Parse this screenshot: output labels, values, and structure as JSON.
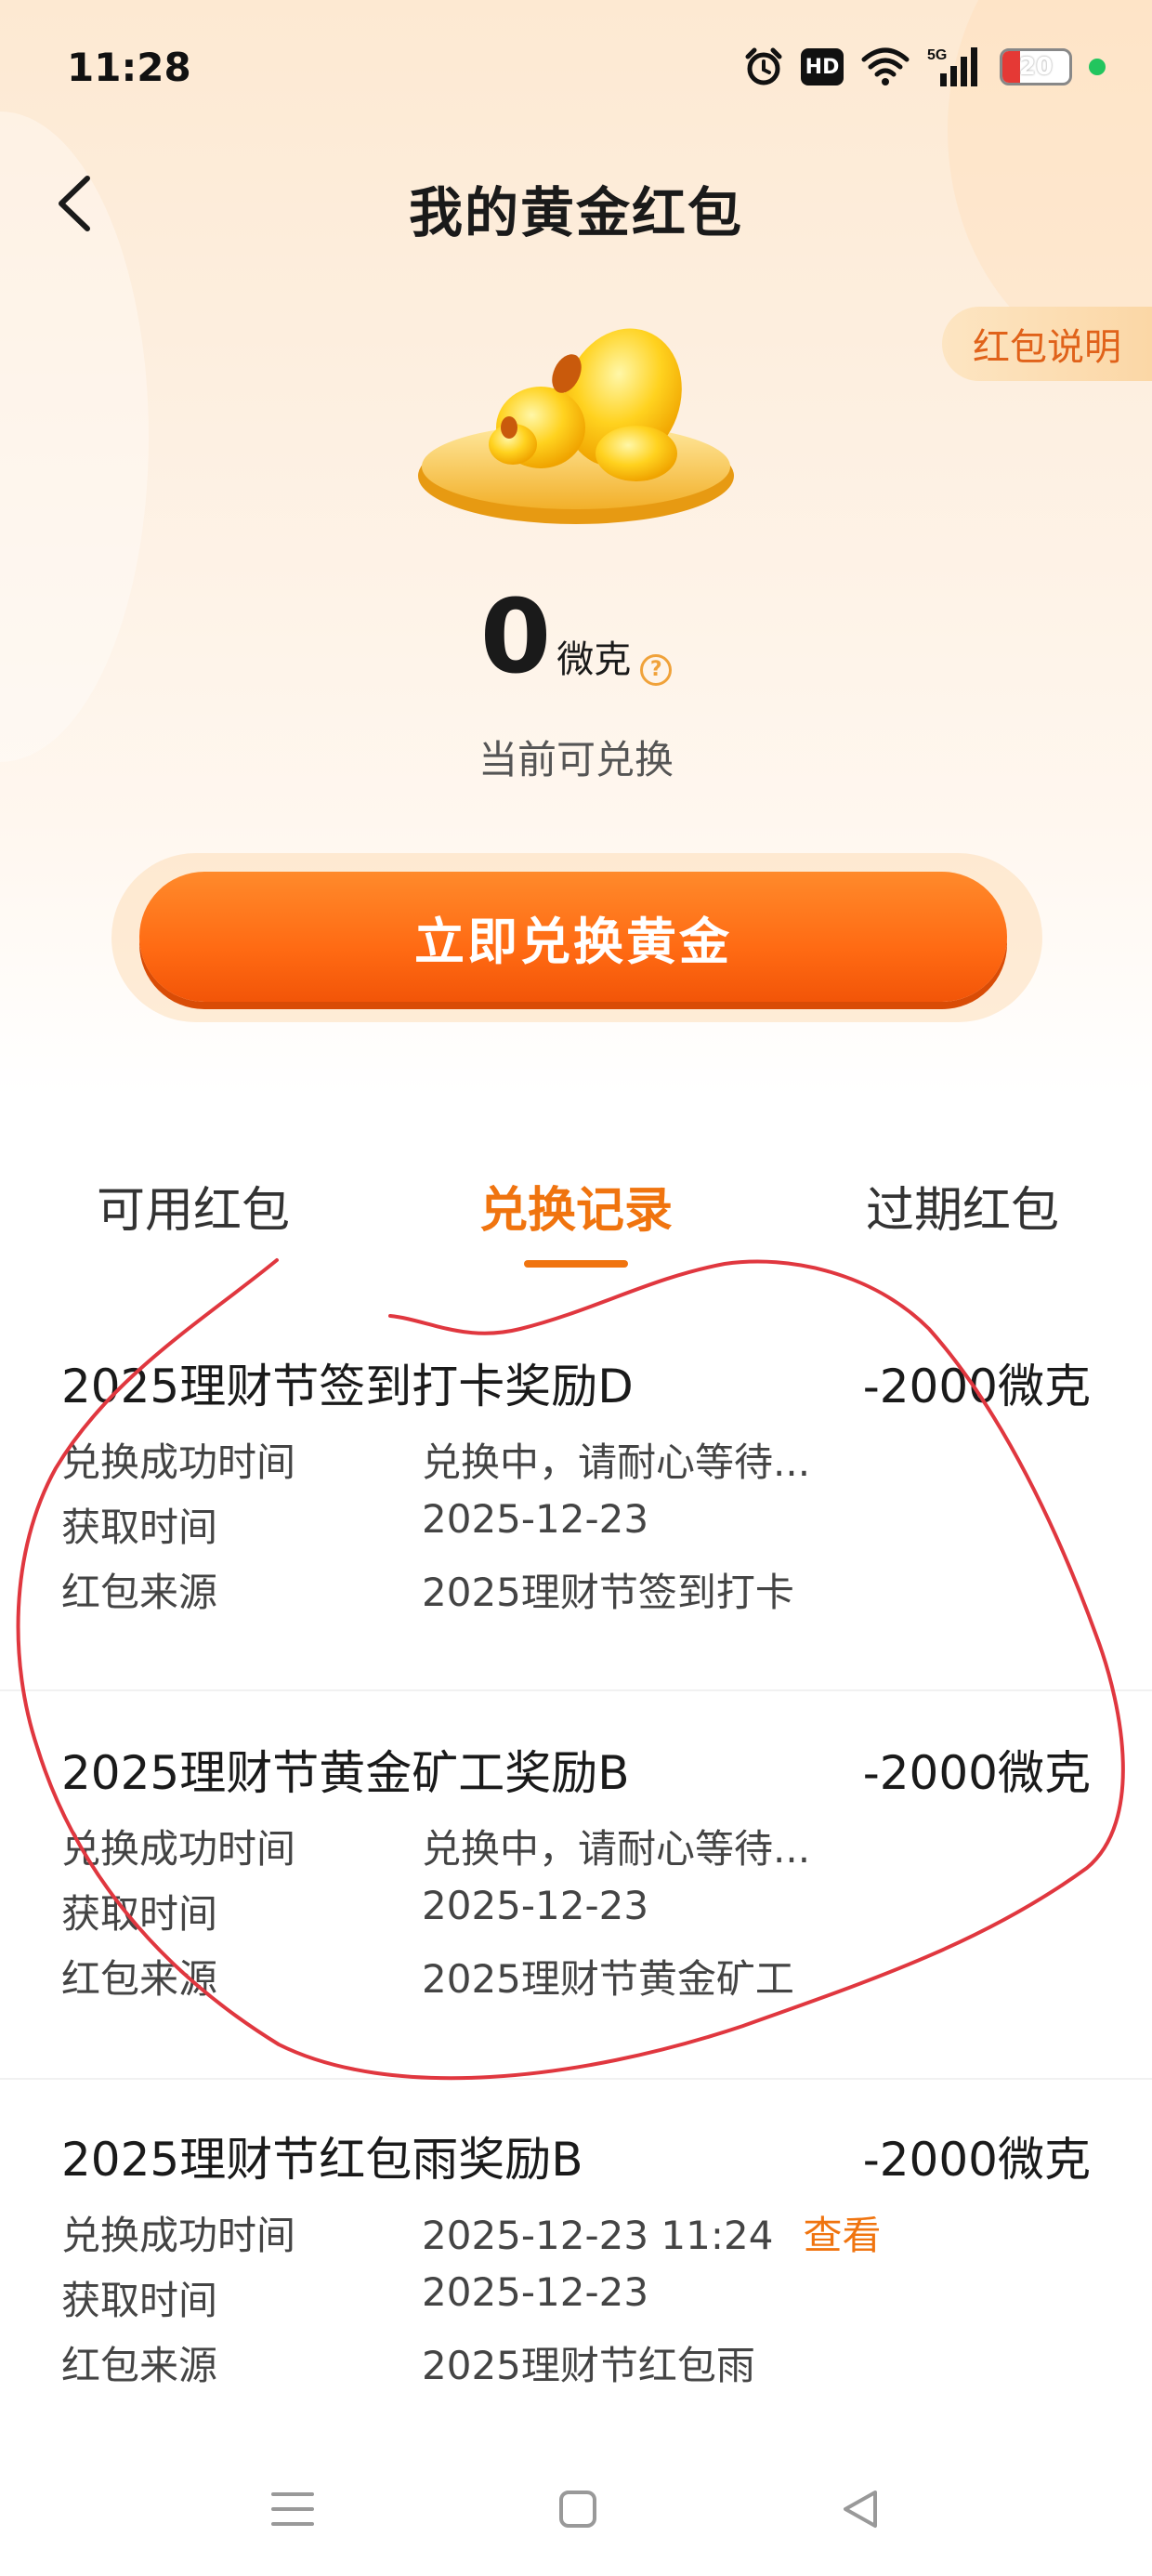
{
  "status_bar": {
    "time": "11:28",
    "hd_label": "HD",
    "network_label": "5G",
    "battery_level": "20",
    "icons": [
      "alarm-icon",
      "hd-icon",
      "wifi-icon",
      "signal-icon",
      "battery-icon"
    ]
  },
  "header": {
    "title": "我的黄金红包",
    "back_icon": "chevron-left-icon",
    "rules_link": "红包说明"
  },
  "balance": {
    "value": "0",
    "unit": "微克",
    "help_icon": "question-circle-icon",
    "caption": "当前可兑换"
  },
  "actions": {
    "redeem_label": "立即兑换黄金"
  },
  "tabs": [
    {
      "label": "可用红包",
      "active": false
    },
    {
      "label": "兑换记录",
      "active": true
    },
    {
      "label": "过期红包",
      "active": false
    }
  ],
  "records": [
    {
      "title": "2025理财节签到打卡奖励D",
      "amount": "-2000微克",
      "rows": [
        {
          "label": "兑换成功时间",
          "value": "兑换中，请耐心等待..."
        },
        {
          "label": "获取时间",
          "value": "2025-12-23"
        },
        {
          "label": "红包来源",
          "value": "2025理财节签到打卡"
        }
      ]
    },
    {
      "title": "2025理财节黄金矿工奖励B",
      "amount": "-2000微克",
      "rows": [
        {
          "label": "兑换成功时间",
          "value": "兑换中，请耐心等待..."
        },
        {
          "label": "获取时间",
          "value": "2025-12-23"
        },
        {
          "label": "红包来源",
          "value": "2025理财节黄金矿工"
        }
      ]
    },
    {
      "title": "2025理财节红包雨奖励B",
      "amount": "-2000微克",
      "rows": [
        {
          "label": "兑换成功时间",
          "value": "2025-12-23 11:24",
          "link": "查看"
        },
        {
          "label": "获取时间",
          "value": "2025-12-23"
        },
        {
          "label": "红包来源",
          "value": "2025理财节红包雨"
        }
      ]
    }
  ],
  "nav_bar": {
    "icons": [
      "menu-icon",
      "home-square-icon",
      "back-triangle-icon"
    ]
  },
  "colors": {
    "accent": "#f0740f",
    "button": "#ff6a13",
    "annotation": "#e0373f"
  }
}
